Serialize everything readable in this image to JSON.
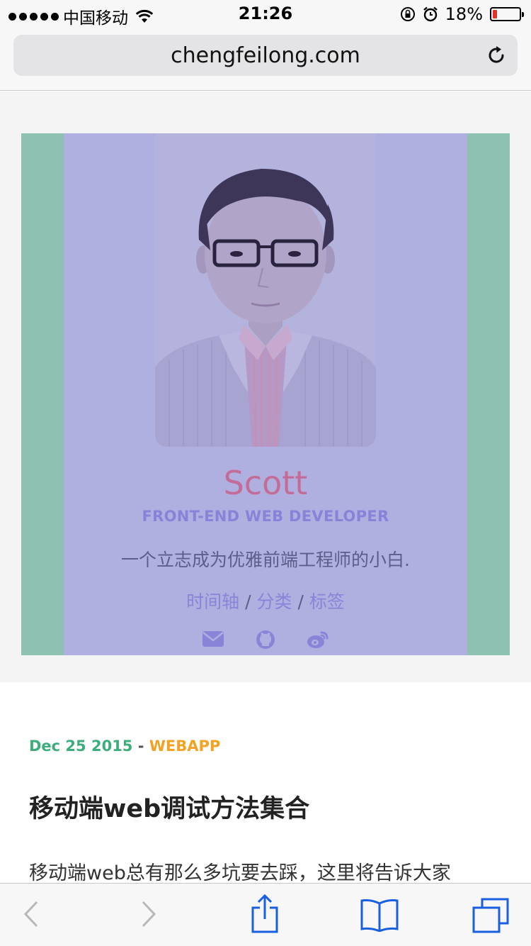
{
  "status_bar": {
    "carrier": "中国移动",
    "time": "21:26",
    "battery_percent": "18%",
    "battery_level": 0.18
  },
  "browser": {
    "url": "chengfeilong.com"
  },
  "profile": {
    "name": "Scott",
    "role": "FRONT-END WEB DEVELOPER",
    "bio": "一个立志成为优雅前端工程师的小白.",
    "links": [
      {
        "label": "时间轴"
      },
      {
        "label": "分类"
      },
      {
        "label": "标签"
      }
    ],
    "link_separator": "/",
    "social_icons": [
      "mail-icon",
      "github-icon",
      "weibo-icon"
    ]
  },
  "post": {
    "date": "Dec 25 2015",
    "separator": "-",
    "category": "WEBAPP",
    "title": "移动端web调试方法集合",
    "excerpt": "移动端web总有那么多坑要去踩，这里将告诉大家"
  },
  "toolbar": {
    "icons": [
      "back-icon",
      "forward-icon",
      "share-icon",
      "bookmarks-icon",
      "tabs-icon"
    ]
  },
  "colors": {
    "accent_blue": "#1a73e8",
    "card_purple": "#b0b0e0",
    "frame_mint": "#8fc1b2",
    "name_pink": "#c46c98",
    "date_green": "#3dae7b",
    "category_orange": "#f2a325"
  }
}
